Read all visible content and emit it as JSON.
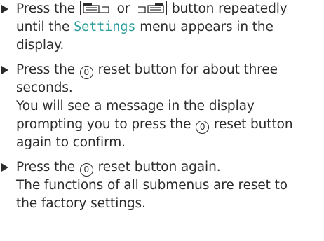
{
  "step1": {
    "l1_a": "Press the",
    "l1_or": "or",
    "l1_b": "button repeatedly",
    "l2_a": "until the",
    "l2_menu": "Settings",
    "l2_b": "menu appears in the",
    "l3": "display."
  },
  "step2": {
    "l1_a": "Press the",
    "l1_sym": "0",
    "l1_b": "reset button for about three",
    "l2": "seconds.",
    "l3": "You will see a message in the display",
    "l4_a": "prompting you to press the",
    "l4_sym": "0",
    "l4_b": "reset button",
    "l5": "again to confirm."
  },
  "step3": {
    "l1_a": "Press the",
    "l1_sym": "0",
    "l1_b": "reset button again.",
    "l2": "The functions of all submenus are reset to",
    "l3": "the factory settings."
  },
  "icons": {
    "bullet": "triangle-bullet-icon",
    "button_prev": "display-page-back-icon",
    "button_next": "display-page-forward-icon",
    "reset": "circled-zero-reset-icon"
  },
  "colors": {
    "text": "#2b2b2b",
    "menu_term": "#2a9d9a"
  }
}
